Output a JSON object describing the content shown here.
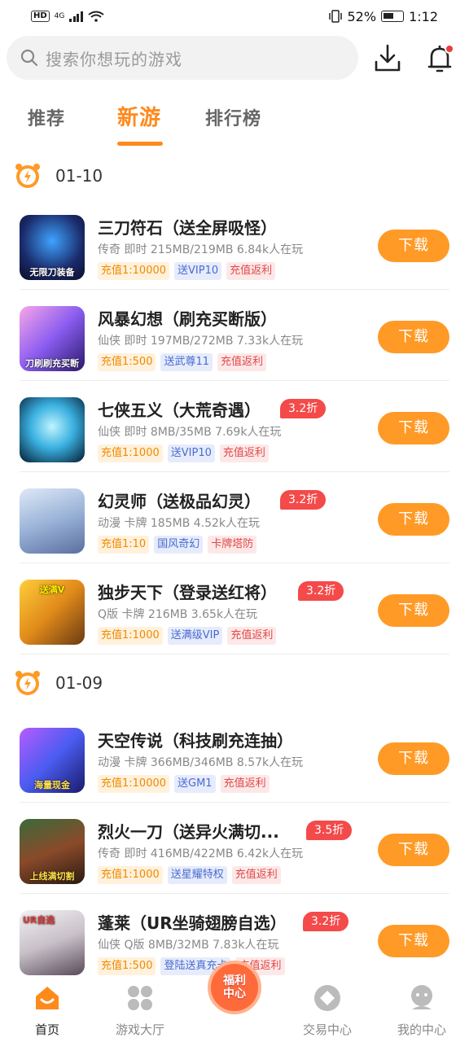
{
  "status_bar": {
    "network": "HD",
    "signal": "4G",
    "battery_percent": "52%",
    "time": "1:12"
  },
  "search": {
    "placeholder": "搜索你想玩的游戏"
  },
  "tabs": [
    {
      "label": "推荐",
      "active": false
    },
    {
      "label": "新游",
      "active": true
    },
    {
      "label": "排行榜",
      "active": false
    }
  ],
  "sections": [
    {
      "date": "01-10",
      "games": [
        {
          "title": "三刀符石（送全屏吸怪）",
          "discount": "",
          "meta": "传奇 即时 215MB/219MB 6.84k人在玩",
          "tags": [
            "充值1:10000",
            "送VIP10",
            "充值返利"
          ],
          "button": "下载",
          "thumb_caption": "无限刀装备"
        },
        {
          "title": "风暴幻想（刷充买断版）",
          "discount": "",
          "meta": "仙侠 即时 197MB/272MB 7.33k人在玩",
          "tags": [
            "充值1:500",
            "送武尊11",
            "充值返利"
          ],
          "button": "下载",
          "thumb_caption": "刀刷刷充买断"
        },
        {
          "title": "七侠五义（大荒奇遇）",
          "discount": "3.2折",
          "meta": "仙侠 即时 8MB/35MB 7.69k人在玩",
          "tags": [
            "充值1:1000",
            "送VIP10",
            "充值返利"
          ],
          "button": "下载",
          "thumb_caption": ""
        },
        {
          "title": "幻灵师（送极品幻灵）",
          "discount": "3.2折",
          "meta": "动漫 卡牌 185MB 4.52k人在玩",
          "tags": [
            "充值1:10",
            "国风奇幻",
            "卡牌塔防"
          ],
          "button": "下载",
          "thumb_caption": ""
        },
        {
          "title": "独步天下（登录送红将）",
          "discount": "3.2折",
          "meta": "Q版 卡牌 216MB 3.65k人在玩",
          "tags": [
            "充值1:1000",
            "送满级VIP",
            "充值返利"
          ],
          "button": "下载",
          "thumb_caption": "送满V"
        }
      ]
    },
    {
      "date": "01-09",
      "games": [
        {
          "title": "天空传说（科技刷充连抽）",
          "discount": "",
          "meta": "动漫 卡牌 366MB/346MB 8.57k人在玩",
          "tags": [
            "充值1:10000",
            "送GM1",
            "充值返利"
          ],
          "button": "下载",
          "thumb_caption": "海量现金"
        },
        {
          "title": "烈火一刀（送异火满切...",
          "discount": "3.5折",
          "meta": "传奇 即时 416MB/422MB 6.42k人在玩",
          "tags": [
            "充值1:1000",
            "送星耀特权",
            "充值返利"
          ],
          "button": "下载",
          "thumb_caption": "上线满切割"
        },
        {
          "title": "蓬莱（UR坐骑翅膀自选）",
          "discount": "3.2折",
          "meta": "仙侠 Q版 8MB/32MB 7.83k人在玩",
          "tags": [
            "充值1:500",
            "登陆送真充卡",
            "充值返利"
          ],
          "button": "下载",
          "thumb_caption": "UR自选"
        }
      ]
    }
  ],
  "bottom_nav": [
    {
      "label": "首页",
      "icon": "home-icon",
      "active": true
    },
    {
      "label": "游戏大厅",
      "icon": "grid-icon",
      "active": false
    },
    {
      "label": "福利中心",
      "icon": "welfare-icon",
      "active": false
    },
    {
      "label": "交易中心",
      "icon": "trade-icon",
      "active": false
    },
    {
      "label": "我的中心",
      "icon": "profile-icon",
      "active": false
    }
  ],
  "colors": {
    "accent": "#ff8a1c",
    "button": "#ff9a26",
    "discount": "#f44a4a"
  }
}
